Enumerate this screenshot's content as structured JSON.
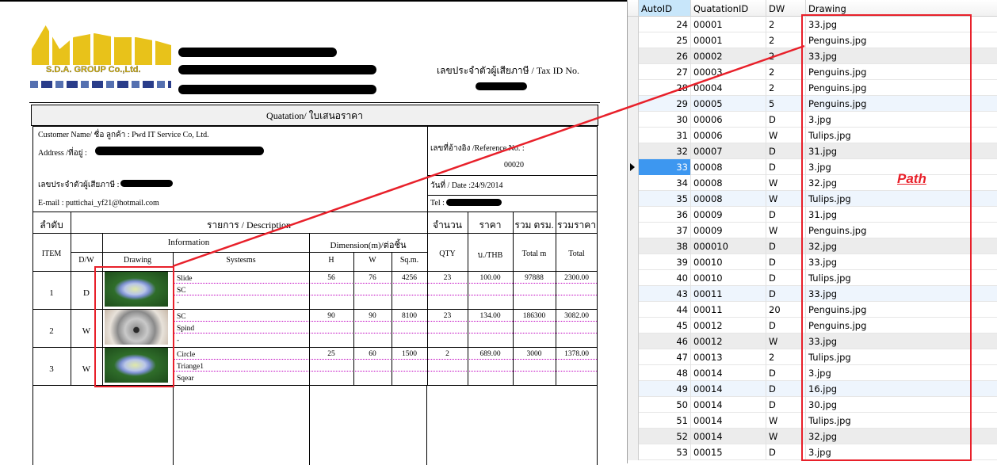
{
  "document": {
    "company_logo_text": "S.D.A. GROUP Co.,Ltd.",
    "tax_id_label": "เลขประจำตัวผู้เสียภาษี / Tax ID No.",
    "title": "Quatation/ ใบเสนอราคา",
    "customer_name": "Customer Name/ ชื่อ ลูกค้า : Pwd IT Service Co, Ltd.",
    "address_label": "Address /ที่อยู่ :",
    "customer_tax_label": "เลขประจำตัวผู้เสียภาษี :",
    "email": "E-mail : puttichai_yf21@hotmail.com",
    "reference_label": "เลขที่อ้างอิง /Reference No. :",
    "reference_value": "00020",
    "date": "วันที่ / Date :24/9/2014",
    "tel_label": "Tel :",
    "headers": {
      "order": "ลำดับ",
      "description": "รายการ / Description",
      "quantity_th": "จำนวน",
      "price_th": "ราคา",
      "total_sqm_th": "รวม ตรม.",
      "total_price_th": "รวมราคา",
      "item": "ITEM",
      "dw": "D/W",
      "information": "Information",
      "dimension": "Dimension(m)/ต่อชิ้น",
      "drawing": "Drawing",
      "systems": "Systesms",
      "h": "H",
      "w": "W",
      "sqm": "Sq.m.",
      "qty": "QTY",
      "unit_price": "บ./THB",
      "total_m": "Total m",
      "total": "Total"
    },
    "items": [
      {
        "item": "1",
        "dw": "D",
        "image": "flower",
        "systems": [
          "Slide",
          "SC",
          "-"
        ],
        "h": "56",
        "w": "76",
        "sqm": "4256",
        "qty": "23",
        "price": "100.00",
        "total_m": "97888",
        "total": "2300.00"
      },
      {
        "item": "2",
        "dw": "W",
        "image": "koala",
        "systems": [
          "SC",
          "Spind",
          "-"
        ],
        "h": "90",
        "w": "90",
        "sqm": "8100",
        "qty": "23",
        "price": "134.00",
        "total_m": "186300",
        "total": "3082.00"
      },
      {
        "item": "3",
        "dw": "W",
        "image": "flower",
        "systems": [
          "Circle",
          "Triange1",
          "Sqear"
        ],
        "h": "25",
        "w": "60",
        "sqm": "1500",
        "qty": "2",
        "price": "689.00",
        "total_m": "3000",
        "total": "1378.00"
      }
    ]
  },
  "grid": {
    "columns": [
      "AutoID",
      "QuatationID",
      "DW",
      "Drawing"
    ],
    "selected_autoid": "33",
    "rows": [
      [
        "24",
        "00001",
        "2",
        "33.jpg"
      ],
      [
        "25",
        "00001",
        "2",
        "Penguins.jpg"
      ],
      [
        "26",
        "00002",
        "2",
        "33.jpg"
      ],
      [
        "27",
        "00003",
        "2",
        "Penguins.jpg"
      ],
      [
        "28",
        "00004",
        "2",
        "Penguins.jpg"
      ],
      [
        "29",
        "00005",
        "5",
        "Penguins.jpg"
      ],
      [
        "30",
        "00006",
        "D",
        "3.jpg"
      ],
      [
        "31",
        "00006",
        "W",
        "Tulips.jpg"
      ],
      [
        "32",
        "00007",
        "D",
        "31.jpg"
      ],
      [
        "33",
        "00008",
        "D",
        "3.jpg"
      ],
      [
        "34",
        "00008",
        "W",
        "32.jpg"
      ],
      [
        "35",
        "00008",
        "W",
        "Tulips.jpg"
      ],
      [
        "36",
        "00009",
        "D",
        "31.jpg"
      ],
      [
        "37",
        "00009",
        "W",
        "Penguins.jpg"
      ],
      [
        "38",
        "000010",
        "D",
        "32.jpg"
      ],
      [
        "39",
        "00010",
        "D",
        "33.jpg"
      ],
      [
        "40",
        "00010",
        "D",
        "Tulips.jpg"
      ],
      [
        "43",
        "00011",
        "D",
        "33.jpg"
      ],
      [
        "44",
        "00011",
        "20",
        "Penguins.jpg"
      ],
      [
        "45",
        "00012",
        "D",
        "Penguins.jpg"
      ],
      [
        "46",
        "00012",
        "W",
        "33.jpg"
      ],
      [
        "47",
        "00013",
        "2",
        "Tulips.jpg"
      ],
      [
        "48",
        "00014",
        "D",
        "3.jpg"
      ],
      [
        "49",
        "00014",
        "D",
        "16.jpg"
      ],
      [
        "50",
        "00014",
        "D",
        "30.jpg"
      ],
      [
        "51",
        "00014",
        "W",
        "Tulips.jpg"
      ],
      [
        "52",
        "00014",
        "W",
        "32.jpg"
      ],
      [
        "53",
        "00015",
        "D",
        "3.jpg"
      ]
    ]
  },
  "annotation": {
    "label": "Path",
    "color": "#e8202a"
  },
  "colors": {
    "selection": "#3d97f0",
    "row_gray": "#ececec",
    "row_blue": "#eef5fd",
    "header_blue": "#c8e6fa"
  }
}
